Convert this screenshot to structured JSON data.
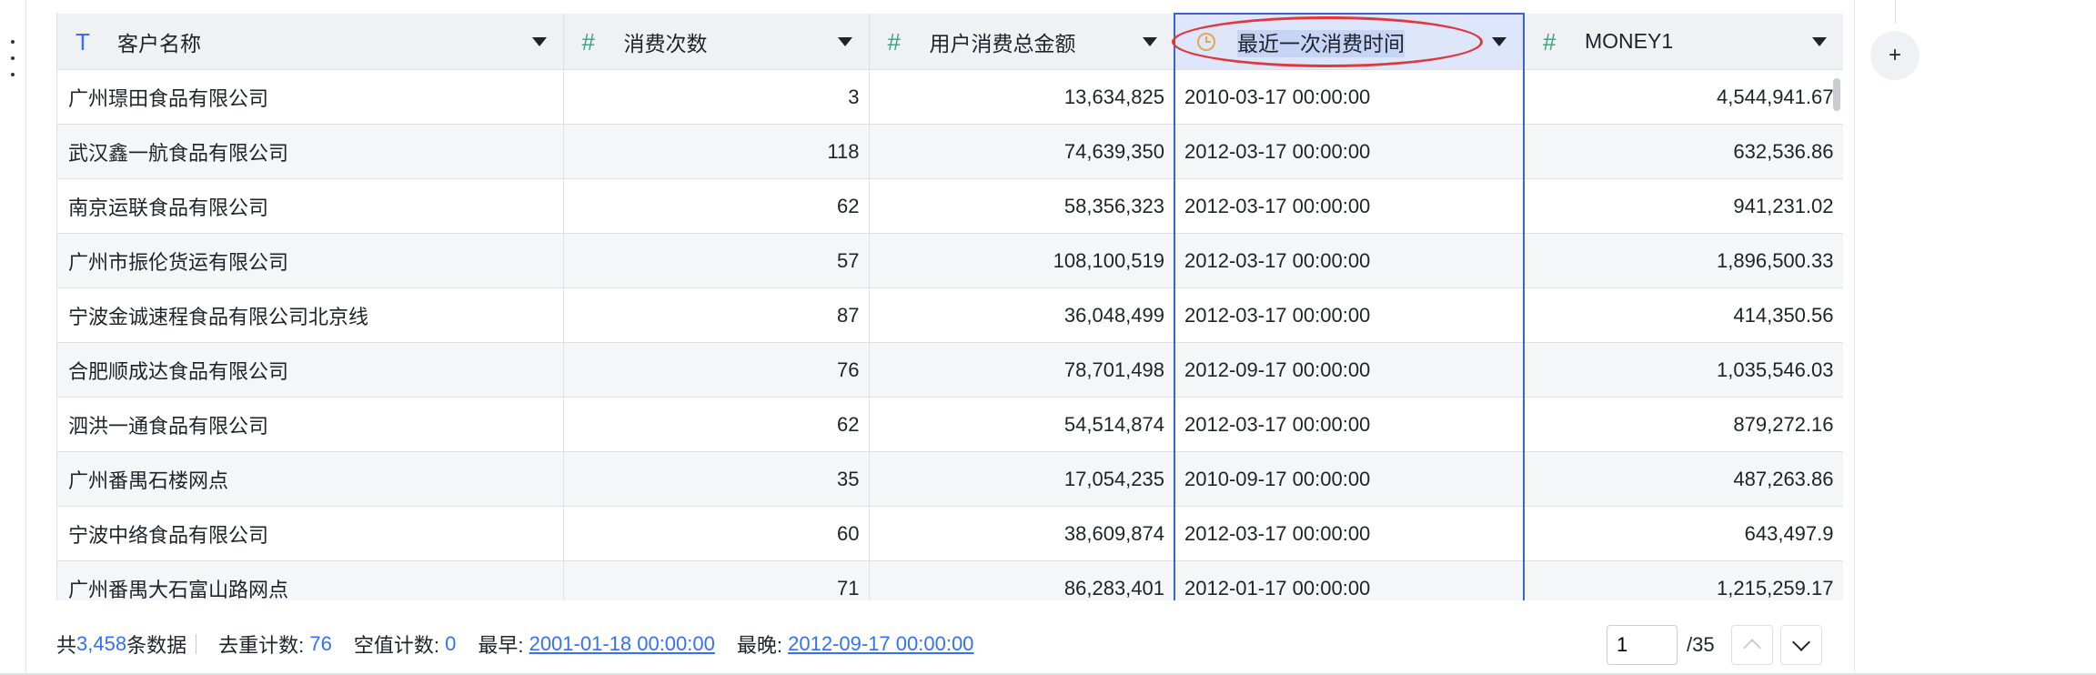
{
  "columns": [
    {
      "type": "text",
      "icon": "T",
      "label": "客户名称",
      "align": "left"
    },
    {
      "type": "number",
      "icon": "#",
      "label": "消费次数",
      "align": "right"
    },
    {
      "type": "number",
      "icon": "#",
      "label": "用户消费总金额",
      "align": "right"
    },
    {
      "type": "datetime",
      "icon": "clock",
      "label": "最近一次消费时间",
      "align": "left",
      "selected": true
    },
    {
      "type": "number",
      "icon": "#",
      "label": "MONEY1",
      "align": "right"
    }
  ],
  "rows": [
    [
      "广州璟田食品有限公司",
      "3",
      "13,634,825",
      "2010-03-17 00:00:00",
      "4,544,941.67"
    ],
    [
      "武汉鑫一航食品有限公司",
      "118",
      "74,639,350",
      "2012-03-17 00:00:00",
      "632,536.86"
    ],
    [
      "南京运联食品有限公司",
      "62",
      "58,356,323",
      "2012-03-17 00:00:00",
      "941,231.02"
    ],
    [
      "广州市振伦货运有限公司",
      "57",
      "108,100,519",
      "2012-03-17 00:00:00",
      "1,896,500.33"
    ],
    [
      "宁波金诚速程食品有限公司北京线",
      "87",
      "36,048,499",
      "2012-03-17 00:00:00",
      "414,350.56"
    ],
    [
      "合肥顺成达食品有限公司",
      "76",
      "78,701,498",
      "2012-09-17 00:00:00",
      "1,035,546.03"
    ],
    [
      "泗洪一通食品有限公司",
      "62",
      "54,514,874",
      "2012-03-17 00:00:00",
      "879,272.16"
    ],
    [
      "广州番禺石楼网点",
      "35",
      "17,054,235",
      "2010-09-17 00:00:00",
      "487,263.86"
    ],
    [
      "宁波中络食品有限公司",
      "60",
      "38,609,874",
      "2012-03-17 00:00:00",
      "643,497.9"
    ],
    [
      "广州番禺大石富山路网点",
      "71",
      "86,283,401",
      "2012-01-17 00:00:00",
      "1,215,259.17"
    ]
  ],
  "footer": {
    "total_prefix": "共",
    "total_count": "3,458",
    "total_suffix": "条数据",
    "distinct_label": "去重计数:",
    "distinct_value": "76",
    "null_label": "空值计数:",
    "null_value": "0",
    "earliest_label": "最早:",
    "earliest_value": "2001-01-18 00:00:00",
    "latest_label": "最晚:",
    "latest_value": "2012-09-17 00:00:00"
  },
  "pager": {
    "current": "1",
    "total": "/35"
  },
  "add_button": "+",
  "colors": {
    "accent": "#3370ff",
    "selection_border": "#3a62d7",
    "annotation": "#e0383b",
    "number_icon": "#2ea87a",
    "clock_icon": "#e8a54b"
  }
}
